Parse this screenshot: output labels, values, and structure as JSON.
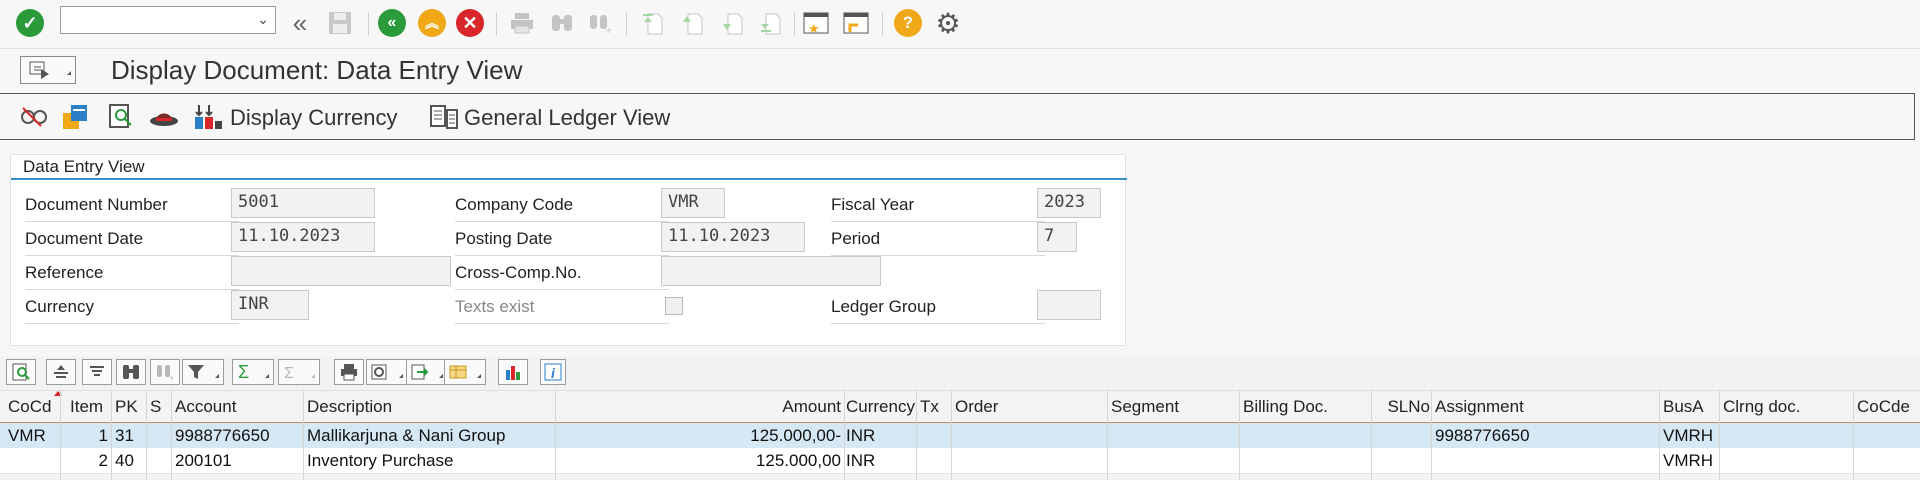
{
  "toolbar": {
    "command_field_value": "",
    "icons": [
      "enter-icon",
      "back-icon",
      "save-icon",
      "back-green-icon",
      "exit-icon",
      "cancel-icon",
      "print-icon",
      "find-icon",
      "find-next-icon",
      "first-page-icon",
      "previous-page-icon",
      "next-page-icon",
      "last-page-icon",
      "create-session-icon",
      "create-shortcut-icon",
      "help-icon",
      "settings-icon"
    ]
  },
  "title": "Display Document: Data Entry View",
  "app_toolbar": {
    "display_currency": "Display Currency",
    "general_ledger_view": "General Ledger View"
  },
  "group": {
    "title": "Data Entry View",
    "document_number": {
      "label": "Document Number",
      "value": "5001"
    },
    "company_code": {
      "label": "Company Code",
      "value": "VMR"
    },
    "fiscal_year": {
      "label": "Fiscal Year",
      "value": "2023"
    },
    "document_date": {
      "label": "Document Date",
      "value": "11.10.2023"
    },
    "posting_date": {
      "label": "Posting Date",
      "value": "11.10.2023"
    },
    "period": {
      "label": "Period",
      "value": "7"
    },
    "reference": {
      "label": "Reference",
      "value": ""
    },
    "cross_comp": {
      "label": "Cross-Comp.No.",
      "value": ""
    },
    "currency": {
      "label": "Currency",
      "value": "INR"
    },
    "texts_exist": {
      "label": "Texts exist",
      "checked": false
    },
    "ledger_group": {
      "label": "Ledger Group",
      "value": ""
    }
  },
  "table": {
    "headers": {
      "cocd": "CoCd",
      "item": "Item",
      "pk": "PK",
      "s": "S",
      "account": "Account",
      "description": "Description",
      "amount": "Amount",
      "currency": "Currency",
      "tx": "Tx",
      "order": "Order",
      "segment": "Segment",
      "billing_doc": "Billing Doc.",
      "slno": "SLNo",
      "assignment": "Assignment",
      "busa": "BusA",
      "clrng_doc": "Clrng doc.",
      "cocde": "CoCde"
    },
    "rows": [
      {
        "cocd": "VMR",
        "item": "1",
        "pk": "31",
        "s": "",
        "account": "9988776650",
        "description": "Mallikarjuna & Nani Group",
        "amount": "125.000,00-",
        "currency": "INR",
        "tx": "",
        "order": "",
        "segment": "",
        "billing_doc": "",
        "slno": "",
        "assignment": "9988776650",
        "busa": "VMRH",
        "clrng_doc": "",
        "cocde": ""
      },
      {
        "cocd": "",
        "item": "2",
        "pk": "40",
        "s": "",
        "account": "200101",
        "description": "Inventory Purchase",
        "amount": "125.000,00",
        "currency": "INR",
        "tx": "",
        "order": "",
        "segment": "",
        "billing_doc": "",
        "slno": "",
        "assignment": "",
        "busa": "VMRH",
        "clrng_doc": "",
        "cocde": ""
      }
    ]
  }
}
